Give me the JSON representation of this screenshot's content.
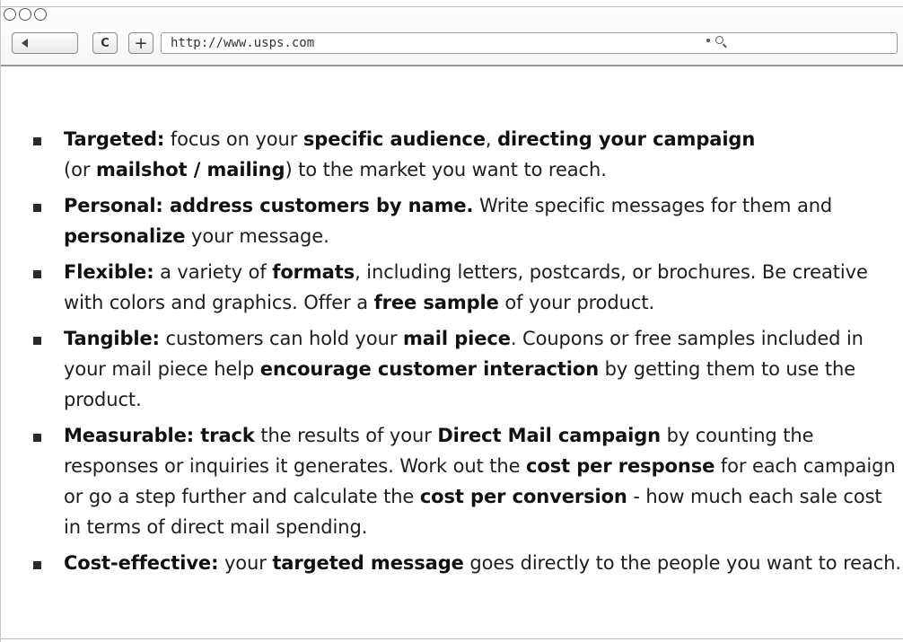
{
  "browser": {
    "url": "http://www.usps.com",
    "reload_label": "C",
    "add_label": "+"
  },
  "features": [
    {
      "parts": [
        {
          "b": true,
          "t": "Targeted:"
        },
        {
          "b": false,
          "t": " focus on your "
        },
        {
          "b": true,
          "t": "specific audience"
        },
        {
          "b": false,
          "t": ", "
        },
        {
          "b": true,
          "t": "directing your campaign"
        },
        {
          "br": true
        },
        {
          "b": false,
          "t": "(or "
        },
        {
          "b": true,
          "t": "mailshot / mailing"
        },
        {
          "b": false,
          "t": ") to the market you want to reach."
        }
      ]
    },
    {
      "parts": [
        {
          "b": true,
          "t": "Personal: address customers by name."
        },
        {
          "b": false,
          "t": " Write specific messages for them and "
        },
        {
          "br": true
        },
        {
          "b": true,
          "t": "personalize"
        },
        {
          "b": false,
          "t": " your message."
        }
      ]
    },
    {
      "parts": [
        {
          "b": true,
          "t": "Flexible:"
        },
        {
          "b": false,
          "t": " a variety of "
        },
        {
          "b": true,
          "t": "formats"
        },
        {
          "b": false,
          "t": ", including letters, postcards, or brochures. Be creative "
        },
        {
          "br": true
        },
        {
          "b": false,
          "t": "with colors and graphics. Offer a "
        },
        {
          "b": true,
          "t": "free sample"
        },
        {
          "b": false,
          "t": " of your product."
        }
      ]
    },
    {
      "parts": [
        {
          "b": true,
          "t": "Tangible:"
        },
        {
          "b": false,
          "t": " customers can hold your "
        },
        {
          "b": true,
          "t": "mail piece"
        },
        {
          "b": false,
          "t": ". Coupons or free samples included in "
        },
        {
          "br": true
        },
        {
          "b": false,
          "t": "your mail piece help "
        },
        {
          "b": true,
          "t": "encourage customer interaction"
        },
        {
          "b": false,
          "t": " by getting them to use the "
        },
        {
          "br": true
        },
        {
          "b": false,
          "t": "product."
        }
      ]
    },
    {
      "parts": [
        {
          "b": true,
          "t": "Measurable: track"
        },
        {
          "b": false,
          "t": " the results of your "
        },
        {
          "b": true,
          "t": "Direct Mail campaign"
        },
        {
          "b": false,
          "t": " by counting the "
        },
        {
          "br": true
        },
        {
          "b": false,
          "t": "responses or inquiries it generates. Work out the "
        },
        {
          "b": true,
          "t": "cost per response"
        },
        {
          "b": false,
          "t": " for each campaign "
        },
        {
          "br": true
        },
        {
          "b": false,
          "t": "or go a step further and calculate the "
        },
        {
          "b": true,
          "t": "cost per conversion"
        },
        {
          "b": false,
          "t": " - how much each sale cost "
        },
        {
          "br": true
        },
        {
          "b": false,
          "t": "in terms of direct mail spending."
        }
      ]
    },
    {
      "parts": [
        {
          "b": true,
          "t": "Cost-effective:"
        },
        {
          "b": false,
          "t": " your "
        },
        {
          "b": true,
          "t": "targeted message"
        },
        {
          "b": false,
          "t": " goes directly to the people you want to reach."
        }
      ]
    }
  ]
}
